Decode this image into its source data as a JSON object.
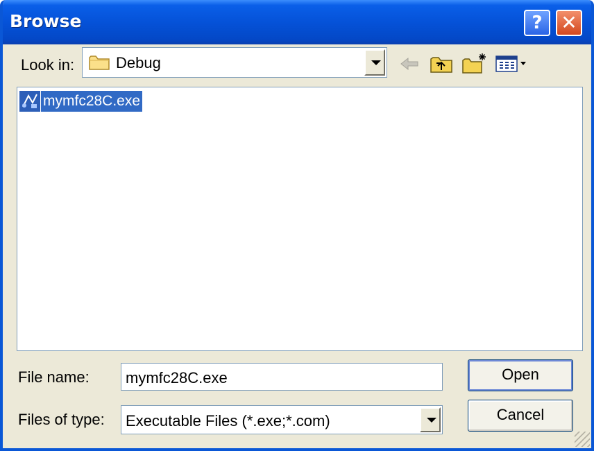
{
  "window": {
    "title": "Browse"
  },
  "titlebar": {
    "help_glyph": "?",
    "close_glyph": "✕"
  },
  "look_in": {
    "label": "Look in:",
    "value": "Debug",
    "folder_icon": "folder-icon"
  },
  "toolbar": [
    {
      "name": "back-icon"
    },
    {
      "name": "up-folder-icon"
    },
    {
      "name": "new-folder-icon"
    },
    {
      "name": "view-menu-icon"
    }
  ],
  "files": [
    {
      "name": "mymfc28C.exe",
      "icon": "executable-file-icon",
      "selected": true
    }
  ],
  "file_name": {
    "label": "File name:",
    "value": "mymfc28C.exe"
  },
  "file_type": {
    "label": "Files of type:",
    "value": "Executable Files (*.exe;*.com)"
  },
  "buttons": {
    "open": "Open",
    "cancel": "Cancel"
  },
  "colors": {
    "titlebar": "#0552d8",
    "selection": "#316ac5",
    "dialog_bg": "#ece9d8"
  }
}
